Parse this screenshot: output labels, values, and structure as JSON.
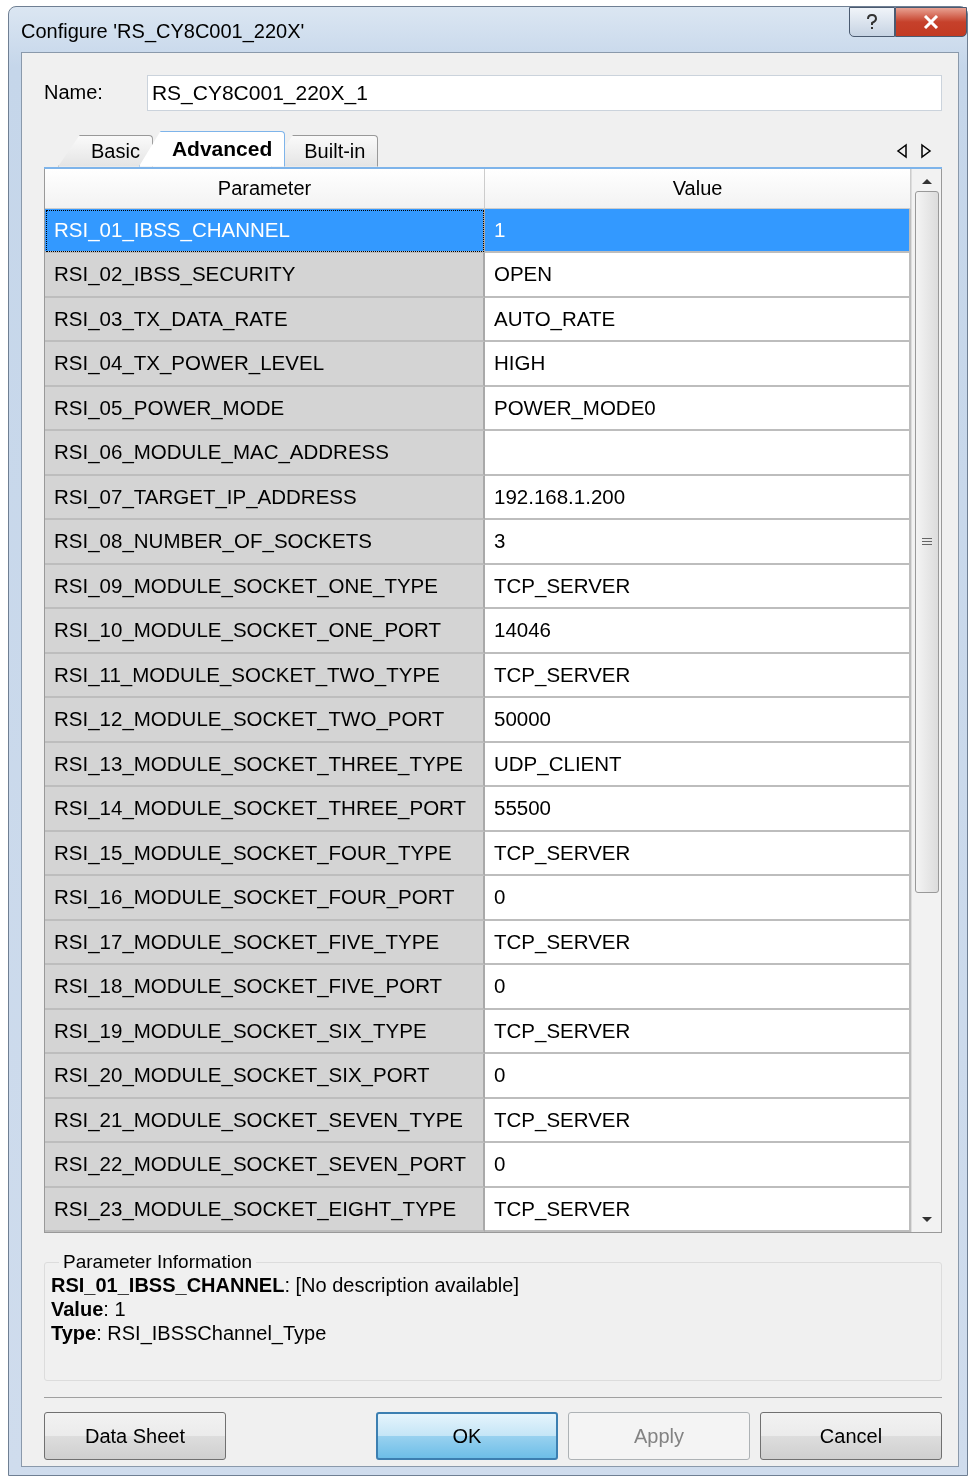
{
  "window": {
    "title": "Configure 'RS_CY8C001_220X'"
  },
  "name_field": {
    "label": "Name:",
    "value": "RS_CY8C001_220X_1"
  },
  "tabs": [
    {
      "label": "Basic",
      "selected": false
    },
    {
      "label": "Advanced",
      "selected": true
    },
    {
      "label": "Built-in",
      "selected": false
    }
  ],
  "table": {
    "columns": [
      "Parameter",
      "Value"
    ],
    "rows": [
      {
        "parameter": "RSI_01_IBSS_CHANNEL",
        "value": "1",
        "selected": true
      },
      {
        "parameter": "RSI_02_IBSS_SECURITY",
        "value": "OPEN",
        "selected": false
      },
      {
        "parameter": "RSI_03_TX_DATA_RATE",
        "value": "AUTO_RATE",
        "selected": false
      },
      {
        "parameter": "RSI_04_TX_POWER_LEVEL",
        "value": "HIGH",
        "selected": false
      },
      {
        "parameter": "RSI_05_POWER_MODE",
        "value": "POWER_MODE0",
        "selected": false
      },
      {
        "parameter": "RSI_06_MODULE_MAC_ADDRESS",
        "selected": false
      },
      {
        "parameter": "RSI_07_TARGET_IP_ADDRESS",
        "value": "192.168.1.200",
        "selected": false
      },
      {
        "parameter": "RSI_08_NUMBER_OF_SOCKETS",
        "value": "3",
        "selected": false
      },
      {
        "parameter": "RSI_09_MODULE_SOCKET_ONE_TYPE",
        "value": "TCP_SERVER",
        "selected": false
      },
      {
        "parameter": "RSI_10_MODULE_SOCKET_ONE_PORT",
        "value": "14046",
        "selected": false
      },
      {
        "parameter": "RSI_11_MODULE_SOCKET_TWO_TYPE",
        "value": "TCP_SERVER",
        "selected": false
      },
      {
        "parameter": "RSI_12_MODULE_SOCKET_TWO_PORT",
        "value": "50000",
        "selected": false
      },
      {
        "parameter": "RSI_13_MODULE_SOCKET_THREE_TYPE",
        "value": "UDP_CLIENT",
        "selected": false
      },
      {
        "parameter": "RSI_14_MODULE_SOCKET_THREE_PORT",
        "value": "55500",
        "selected": false
      },
      {
        "parameter": "RSI_15_MODULE_SOCKET_FOUR_TYPE",
        "value": "TCP_SERVER",
        "selected": false
      },
      {
        "parameter": "RSI_16_MODULE_SOCKET_FOUR_PORT",
        "value": "0",
        "selected": false
      },
      {
        "parameter": "RSI_17_MODULE_SOCKET_FIVE_TYPE",
        "value": "TCP_SERVER",
        "selected": false
      },
      {
        "parameter": "RSI_18_MODULE_SOCKET_FIVE_PORT",
        "value": "0",
        "selected": false
      },
      {
        "parameter": "RSI_19_MODULE_SOCKET_SIX_TYPE",
        "value": "TCP_SERVER",
        "selected": false
      },
      {
        "parameter": "RSI_20_MODULE_SOCKET_SIX_PORT",
        "value": "0",
        "selected": false
      },
      {
        "parameter": "RSI_21_MODULE_SOCKET_SEVEN_TYPE",
        "value": "TCP_SERVER",
        "selected": false
      },
      {
        "parameter": "RSI_22_MODULE_SOCKET_SEVEN_PORT",
        "value": "0",
        "selected": false
      },
      {
        "parameter": "RSI_23_MODULE_SOCKET_EIGHT_TYPE",
        "value": "TCP_SERVER",
        "selected": false
      }
    ]
  },
  "parameter_information": {
    "title": "Parameter Information",
    "lines": [
      "**RSI_01_IBSS_CHANNEL**: [No description available]",
      "**Value**: 1",
      "**Type**: RSI_IBSSChannel_Type"
    ]
  },
  "buttons": [
    {
      "label": "Data Sheet",
      "kind": "normal"
    },
    {
      "label": "OK",
      "kind": "default"
    },
    {
      "label": "Apply",
      "kind": "disabled"
    },
    {
      "label": "Cancel",
      "kind": "normal"
    }
  ]
}
